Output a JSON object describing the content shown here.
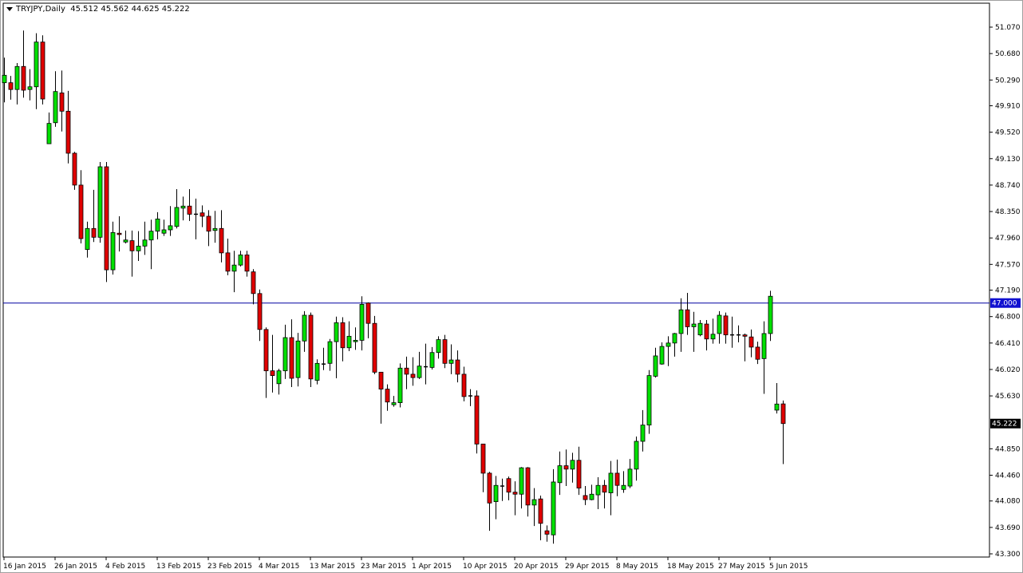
{
  "header": {
    "symbol": "TRYJPY,Daily",
    "ohlc": "45.512 45.562 44.625 45.222"
  },
  "colors": {
    "bull": "#00e000",
    "bear": "#e00000",
    "hline": "#0000a0",
    "hline_label_bg": "#1010d0",
    "price_label_bg": "#000000"
  },
  "chart_data": {
    "type": "candlestick",
    "title": "TRYJPY,Daily",
    "ylim": [
      43.3,
      51.07
    ],
    "y_ticks": [
      "51.070",
      "50.680",
      "50.290",
      "49.910",
      "49.520",
      "49.130",
      "48.740",
      "48.350",
      "47.960",
      "47.570",
      "47.190",
      "46.800",
      "46.410",
      "46.020",
      "45.630",
      "44.850",
      "44.460",
      "44.080",
      "43.690",
      "43.300"
    ],
    "x_ticks": [
      {
        "index": 0,
        "label": "16 Jan 2015"
      },
      {
        "index": 8,
        "label": "26 Jan 2015"
      },
      {
        "index": 16,
        "label": "4 Feb 2015"
      },
      {
        "index": 24,
        "label": "13 Feb 2015"
      },
      {
        "index": 32,
        "label": "23 Feb 2015"
      },
      {
        "index": 40,
        "label": "4 Mar 2015"
      },
      {
        "index": 48,
        "label": "13 Mar 2015"
      },
      {
        "index": 56,
        "label": "23 Mar 2015"
      },
      {
        "index": 64,
        "label": "1 Apr 2015"
      },
      {
        "index": 72,
        "label": "10 Apr 2015"
      },
      {
        "index": 80,
        "label": "20 Apr 2015"
      },
      {
        "index": 88,
        "label": "29 Apr 2015"
      },
      {
        "index": 96,
        "label": "8 May 2015"
      },
      {
        "index": 104,
        "label": "18 May 2015"
      },
      {
        "index": 112,
        "label": "27 May 2015"
      },
      {
        "index": 120,
        "label": "5 Jun 2015"
      }
    ],
    "horizontal_line": {
      "value": 47.0,
      "label": "47.000"
    },
    "current_price": {
      "value": 45.222,
      "label": "45.222"
    },
    "ohlc_columns": [
      "open",
      "high",
      "low",
      "close"
    ],
    "candles": [
      [
        50.25,
        50.62,
        49.96,
        50.36
      ],
      [
        50.25,
        50.35,
        50.0,
        50.15
      ],
      [
        50.15,
        50.54,
        49.93,
        50.49
      ],
      [
        50.49,
        51.02,
        50.03,
        50.14
      ],
      [
        50.15,
        50.45,
        49.99,
        50.19
      ],
      [
        50.19,
        50.98,
        49.86,
        50.85
      ],
      [
        50.85,
        50.95,
        49.93,
        50.01
      ],
      [
        49.35,
        49.81,
        49.35,
        49.65
      ],
      [
        49.66,
        50.42,
        49.6,
        50.12
      ],
      [
        50.1,
        50.43,
        49.53,
        49.83
      ],
      [
        49.83,
        50.13,
        49.06,
        49.21
      ],
      [
        49.21,
        49.23,
        48.67,
        48.74
      ],
      [
        48.74,
        48.96,
        47.88,
        47.95
      ],
      [
        47.79,
        48.2,
        47.67,
        48.1
      ],
      [
        48.1,
        48.67,
        47.9,
        47.97
      ],
      [
        47.97,
        49.08,
        47.89,
        49.01
      ],
      [
        49.01,
        49.08,
        47.31,
        47.49
      ],
      [
        47.49,
        48.2,
        47.42,
        48.04
      ],
      [
        48.03,
        48.28,
        47.76,
        48.01
      ],
      [
        47.9,
        48.07,
        47.88,
        47.93
      ],
      [
        47.92,
        48.07,
        47.39,
        47.77
      ],
      [
        47.77,
        48.06,
        47.62,
        47.84
      ],
      [
        47.84,
        48.2,
        47.71,
        47.93
      ],
      [
        47.93,
        48.23,
        47.5,
        48.06
      ],
      [
        48.06,
        48.34,
        47.94,
        48.24
      ],
      [
        48.03,
        48.23,
        47.99,
        48.08
      ],
      [
        48.08,
        48.43,
        47.99,
        48.14
      ],
      [
        48.13,
        48.68,
        48.1,
        48.41
      ],
      [
        48.4,
        48.57,
        48.22,
        48.43
      ],
      [
        48.43,
        48.68,
        48.21,
        48.31
      ],
      [
        48.31,
        48.54,
        47.94,
        48.31
      ],
      [
        48.33,
        48.44,
        48.12,
        48.28
      ],
      [
        48.28,
        48.37,
        47.84,
        48.06
      ],
      [
        48.07,
        48.36,
        47.89,
        48.1
      ],
      [
        48.1,
        48.37,
        47.6,
        47.74
      ],
      [
        47.74,
        47.95,
        47.41,
        47.47
      ],
      [
        47.47,
        47.77,
        47.16,
        47.56
      ],
      [
        47.56,
        47.77,
        47.54,
        47.71
      ],
      [
        47.71,
        47.77,
        47.39,
        47.47
      ],
      [
        47.46,
        47.5,
        46.98,
        47.14
      ],
      [
        47.14,
        47.2,
        46.44,
        46.61
      ],
      [
        46.61,
        46.64,
        45.6,
        46.0
      ],
      [
        46.0,
        46.53,
        45.68,
        45.93
      ],
      [
        45.81,
        46.03,
        45.65,
        46.0
      ],
      [
        46.0,
        46.68,
        45.88,
        46.49
      ],
      [
        46.49,
        46.76,
        45.76,
        45.89
      ],
      [
        45.9,
        46.56,
        45.77,
        46.44
      ],
      [
        46.44,
        46.88,
        46.28,
        46.82
      ],
      [
        46.82,
        46.86,
        45.76,
        45.88
      ],
      [
        45.86,
        46.17,
        45.8,
        46.11
      ],
      [
        46.1,
        46.34,
        46.01,
        46.1
      ],
      [
        46.11,
        46.47,
        46.0,
        46.43
      ],
      [
        46.43,
        46.8,
        45.89,
        46.71
      ],
      [
        46.71,
        46.79,
        46.14,
        46.34
      ],
      [
        46.34,
        46.73,
        46.29,
        46.51
      ],
      [
        46.43,
        46.64,
        46.31,
        46.45
      ],
      [
        46.45,
        47.1,
        46.3,
        46.98
      ],
      [
        47.0,
        47.01,
        46.48,
        46.7
      ],
      [
        46.7,
        46.81,
        45.95,
        45.98
      ],
      [
        45.98,
        45.98,
        45.22,
        45.73
      ],
      [
        45.73,
        45.8,
        45.41,
        45.54
      ],
      [
        45.5,
        45.63,
        45.47,
        45.53
      ],
      [
        45.53,
        46.11,
        45.46,
        46.04
      ],
      [
        46.04,
        46.21,
        45.73,
        45.95
      ],
      [
        45.95,
        46.2,
        45.78,
        45.9
      ],
      [
        45.9,
        46.28,
        45.88,
        46.07
      ],
      [
        46.06,
        46.4,
        45.8,
        46.06
      ],
      [
        46.05,
        46.35,
        46.02,
        46.27
      ],
      [
        46.27,
        46.51,
        46.18,
        46.46
      ],
      [
        46.46,
        46.53,
        46.04,
        46.11
      ],
      [
        46.11,
        46.39,
        45.95,
        46.16
      ],
      [
        46.16,
        46.3,
        45.83,
        45.95
      ],
      [
        45.95,
        46.06,
        45.55,
        45.62
      ],
      [
        45.63,
        45.73,
        45.48,
        45.63
      ],
      [
        45.63,
        45.71,
        44.78,
        44.92
      ],
      [
        44.92,
        44.92,
        44.21,
        44.49
      ],
      [
        44.49,
        44.51,
        43.64,
        44.05
      ],
      [
        44.07,
        44.45,
        43.81,
        44.31
      ],
      [
        44.3,
        44.41,
        44.08,
        44.3
      ],
      [
        44.41,
        44.44,
        44.09,
        44.21
      ],
      [
        44.21,
        44.37,
        43.87,
        44.18
      ],
      [
        44.18,
        44.58,
        43.97,
        44.57
      ],
      [
        44.57,
        44.58,
        43.85,
        44.02
      ],
      [
        44.02,
        44.27,
        43.71,
        44.1
      ],
      [
        44.11,
        44.16,
        43.5,
        43.75
      ],
      [
        43.64,
        43.72,
        43.48,
        43.59
      ],
      [
        43.58,
        44.55,
        43.45,
        44.36
      ],
      [
        44.35,
        44.81,
        44.17,
        44.6
      ],
      [
        44.6,
        44.84,
        44.3,
        44.55
      ],
      [
        44.55,
        44.79,
        44.35,
        44.68
      ],
      [
        44.68,
        44.88,
        44.17,
        44.27
      ],
      [
        44.16,
        44.3,
        44.02,
        44.1
      ],
      [
        44.1,
        44.32,
        44.09,
        44.18
      ],
      [
        44.17,
        44.43,
        43.96,
        44.31
      ],
      [
        44.31,
        44.39,
        43.97,
        44.21
      ],
      [
        44.2,
        44.67,
        43.87,
        44.49
      ],
      [
        44.49,
        44.69,
        44.15,
        44.31
      ],
      [
        44.25,
        44.52,
        44.2,
        44.31
      ],
      [
        44.3,
        44.7,
        44.27,
        44.55
      ],
      [
        44.55,
        45.03,
        44.38,
        44.96
      ],
      [
        44.96,
        45.42,
        44.81,
        45.2
      ],
      [
        45.2,
        46.01,
        45.07,
        45.93
      ],
      [
        45.92,
        46.34,
        45.9,
        46.22
      ],
      [
        46.1,
        46.42,
        46.09,
        46.36
      ],
      [
        46.36,
        46.51,
        46.07,
        46.41
      ],
      [
        46.41,
        46.56,
        46.21,
        46.55
      ],
      [
        46.55,
        47.07,
        46.28,
        46.9
      ],
      [
        46.9,
        47.15,
        46.53,
        46.65
      ],
      [
        46.65,
        46.87,
        46.28,
        46.69
      ],
      [
        46.53,
        46.75,
        46.51,
        46.7
      ],
      [
        46.69,
        46.75,
        46.3,
        46.47
      ],
      [
        46.47,
        46.77,
        46.4,
        46.54
      ],
      [
        46.55,
        46.88,
        46.4,
        46.82
      ],
      [
        46.81,
        46.86,
        46.4,
        46.53
      ],
      [
        46.53,
        46.8,
        46.34,
        46.53
      ],
      [
        46.53,
        46.67,
        46.42,
        46.53
      ],
      [
        46.53,
        46.55,
        46.14,
        46.51
      ],
      [
        46.5,
        46.61,
        46.2,
        46.35
      ],
      [
        46.35,
        46.43,
        46.1,
        46.17
      ],
      [
        46.18,
        46.73,
        45.66,
        46.55
      ],
      [
        46.55,
        47.18,
        46.44,
        47.1
      ],
      [
        45.42,
        45.82,
        45.37,
        45.51
      ],
      [
        45.512,
        45.562,
        44.625,
        45.222
      ]
    ]
  }
}
